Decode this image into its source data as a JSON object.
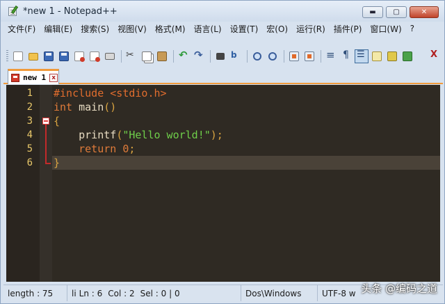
{
  "window": {
    "title": "*new 1 - Notepad++"
  },
  "title_buttons": {
    "minimize": "▬",
    "maximize": "▢",
    "close": "✕"
  },
  "menu": [
    "文件(F)",
    "编辑(E)",
    "搜索(S)",
    "视图(V)",
    "格式(M)",
    "语言(L)",
    "设置(T)",
    "宏(O)",
    "运行(R)",
    "插件(P)",
    "窗口(W)",
    "?"
  ],
  "toolbar": {
    "items": [
      "new-icon",
      "open-icon",
      "save-icon",
      "save-all-icon",
      "close-icon",
      "close-all-icon",
      "print-icon",
      "|",
      "cut-icon",
      "copy-icon",
      "paste-icon",
      "|",
      "undo-icon",
      "redo-icon",
      "|",
      "find-icon",
      "replace-icon",
      "|",
      "zoom-in-icon",
      "zoom-out-icon",
      "|",
      "sync-v-icon",
      "sync-h-icon",
      "|",
      "word-wrap-icon",
      "show-all-chars-icon",
      "indent-guide-icon",
      "user-lang-icon",
      "macro-record-icon",
      "macro-play-icon"
    ],
    "active": "indent-guide-icon",
    "close_label": "X"
  },
  "tab": {
    "label": "new 1",
    "close": "x"
  },
  "editor": {
    "current_line": 6,
    "lines": [
      {
        "n": "1",
        "tokens": [
          {
            "t": "#include <stdio.h>",
            "c": "pre"
          }
        ]
      },
      {
        "n": "2",
        "tokens": [
          {
            "t": "int",
            "c": "kw"
          },
          {
            "t": " main",
            "c": "id"
          },
          {
            "t": "()",
            "c": "op"
          }
        ]
      },
      {
        "n": "3",
        "tokens": [
          {
            "t": "{",
            "c": "op"
          }
        ]
      },
      {
        "n": "4",
        "tokens": [
          {
            "t": "    printf",
            "c": "id"
          },
          {
            "t": "(",
            "c": "op"
          },
          {
            "t": "\"Hello world!\"",
            "c": "str"
          },
          {
            "t": ");",
            "c": "op"
          }
        ]
      },
      {
        "n": "5",
        "tokens": [
          {
            "t": "    return",
            "c": "kw"
          },
          {
            "t": " ",
            "c": "id"
          },
          {
            "t": "0",
            "c": "num"
          },
          {
            "t": ";",
            "c": "op"
          }
        ]
      },
      {
        "n": "6",
        "tokens": [
          {
            "t": "}",
            "c": "op"
          }
        ]
      }
    ]
  },
  "status": {
    "length": "length : 75",
    "lines_prefix": "li",
    "ln": "Ln : 6",
    "col": "Col : 2",
    "sel": "Sel : 0 | 0",
    "eol": "Dos\\Windows",
    "encoding": "UTF-8 w"
  },
  "watermark": "头条 @编码之道",
  "colors": {
    "accent": "#f09a3b",
    "editor_bg": "#2f2a23",
    "line_number": "#e8c86a",
    "string": "#6fcf4a",
    "keyword": "#e07b3a"
  }
}
